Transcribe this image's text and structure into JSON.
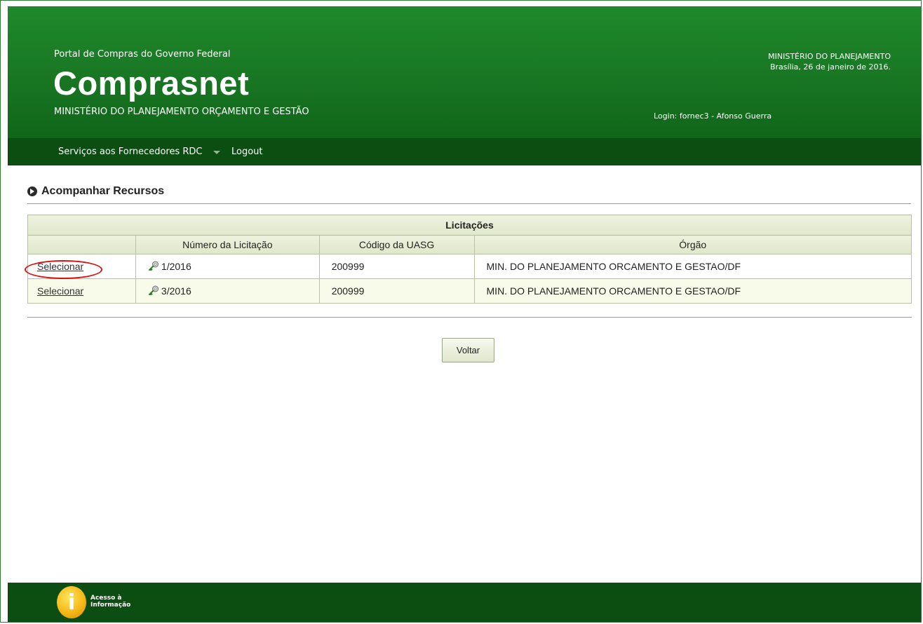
{
  "header": {
    "portal_title": "Portal de Compras do Governo Federal",
    "brand": "Comprasnet",
    "ministry_full": "MINISTÉRIO DO PLANEJAMENTO ORÇAMENTO E GESTÃO",
    "ministry_short": "MINISTÉRIO DO PLANEJAMENTO",
    "date": "Brasília, 26 de janeiro de 2016.",
    "login": "Login: fornec3 - Afonso Guerra"
  },
  "nav": {
    "rdc_label": "Serviços aos Fornecedores RDC",
    "logout_label": "Logout"
  },
  "page": {
    "title": "Acompanhar Recursos"
  },
  "table": {
    "caption": "Licitações",
    "headers": [
      "",
      "Número da Licitação",
      "Código da UASG",
      "Órgão"
    ],
    "rows": [
      {
        "action": "Selecionar",
        "numero": "1/2016",
        "uasg": "200999",
        "orgao": "MIN. DO PLANEJAMENTO ORCAMENTO E GESTAO/DF"
      },
      {
        "action": "Selecionar",
        "numero": "3/2016",
        "uasg": "200999",
        "orgao": "MIN. DO PLANEJAMENTO ORCAMENTO E GESTAO/DF"
      }
    ]
  },
  "buttons": {
    "voltar": "Voltar"
  },
  "footer": {
    "acesso_line1": "Acesso à",
    "acesso_line2": "Informação"
  },
  "colors": {
    "header_green": "#1a7a25",
    "nav_dark_green": "#0c4d12",
    "highlight_red": "#dd1111"
  }
}
